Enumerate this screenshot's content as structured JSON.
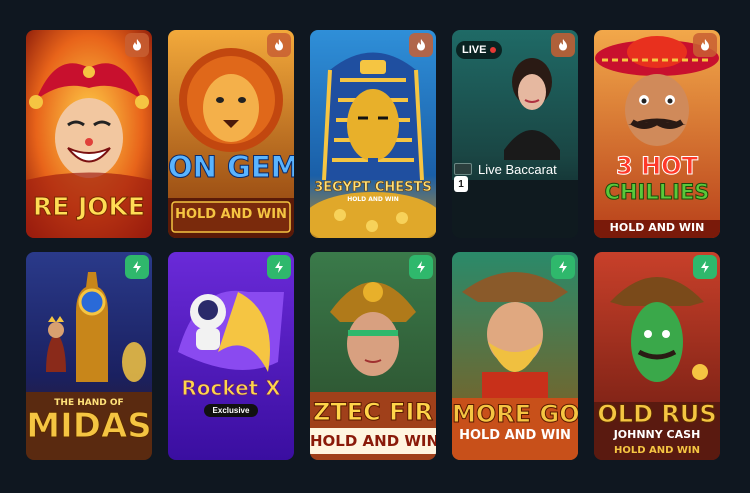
{
  "games": [
    {
      "id": "fire-joker",
      "title": "RE JOKE",
      "badge": "flame-icon"
    },
    {
      "id": "lion-gems",
      "title": "ON GEM",
      "subtitle": "HOLD AND WIN",
      "badge": "flame-icon"
    },
    {
      "id": "egypt-chests",
      "title": "3EGYPT CHESTS",
      "subtitle": "HOLD AND WIN",
      "badge": "flame-icon"
    },
    {
      "id": "live-baccarat",
      "title": "Live Baccarat",
      "live": "LIVE",
      "count": "1",
      "badge": "flame-icon"
    },
    {
      "id": "hot-chillies",
      "title": "3 HOT",
      "title2": "CHILLIES",
      "subtitle": "HOLD AND WIN",
      "badge": "flame-icon"
    },
    {
      "id": "hand-of-midas",
      "title": "MIDAS",
      "title_small": "THE HAND OF",
      "badge": "bolt-icon"
    },
    {
      "id": "rocket-x",
      "title": "Rocket X",
      "subtitle": "Exclusive",
      "badge": "bolt-icon"
    },
    {
      "id": "aztec-fire",
      "title": "ZTEC FIR",
      "subtitle": "HOLD AND WIN",
      "badge": "bolt-icon"
    },
    {
      "id": "more-gold",
      "title": "MORE GO",
      "subtitle": "HOLD AND WIN",
      "badge": "bolt-icon"
    },
    {
      "id": "gold-rush",
      "title": "OLD RUS",
      "title_small": "JOHNNY CASH",
      "subtitle": "HOLD AND WIN",
      "badge": "bolt-icon"
    }
  ],
  "colors": {
    "background": "#0f1720",
    "hot_badge": "#c85f32",
    "new_badge": "#2fb86c",
    "gold": "#f5c542"
  }
}
